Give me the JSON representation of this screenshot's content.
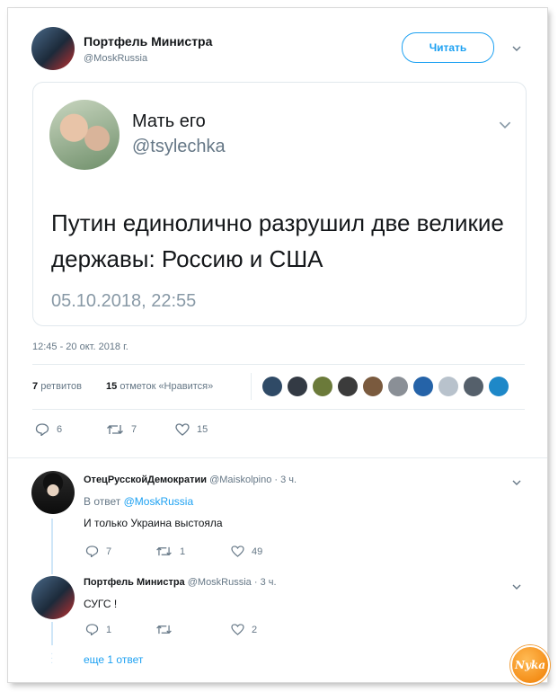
{
  "tweet": {
    "author_name": "Портфель Министра",
    "author_handle": "@MoskRussia",
    "follow_label": "Читать",
    "timestamp": "12:45 - 20 окт. 2018 г.",
    "retweets_count": "7",
    "retweets_label": "ретвитов",
    "likes_count": "15",
    "likes_label": "отметок «Нравится»",
    "actions": {
      "replies": "6",
      "retweets": "7",
      "likes": "15"
    }
  },
  "quoted": {
    "author_name": "Мать его",
    "author_handle": "@tsylechka",
    "text": "Путин единолично разрушил две великие державы: Россию и США",
    "date": "05.10.2018, 22:55"
  },
  "likers": [
    {
      "color": "#2f4a66"
    },
    {
      "color": "#333a44"
    },
    {
      "color": "#6b7a3a"
    },
    {
      "color": "#3b3b3b"
    },
    {
      "color": "#7a5a3e"
    },
    {
      "color": "#8a8f96"
    },
    {
      "color": "#2563a8"
    },
    {
      "color": "#b8c2cc"
    },
    {
      "color": "#55606b"
    },
    {
      "color": "#1e88c8"
    }
  ],
  "replies": [
    {
      "author_name": "ОтецРусскойДемократии",
      "author_handle": "@Maiskolpino",
      "time": "· 3 ч.",
      "reply_prefix": "В ответ",
      "reply_to": "@MoskRussia",
      "text": "И только Украина выстояла",
      "actions": {
        "replies": "7",
        "retweets": "1",
        "likes": "49"
      }
    },
    {
      "author_name": "Портфель Министра",
      "author_handle": "@MoskRussia",
      "time": "· 3 ч.",
      "text": "СУГС !",
      "actions": {
        "replies": "1",
        "retweets": "",
        "likes": "2"
      }
    }
  ],
  "more_replies": "еще 1 ответ",
  "watermark": "Nyka",
  "colors": {
    "accent": "#1da1f2",
    "text": "#14171a",
    "muted": "#657786",
    "like": "#e0245e"
  }
}
